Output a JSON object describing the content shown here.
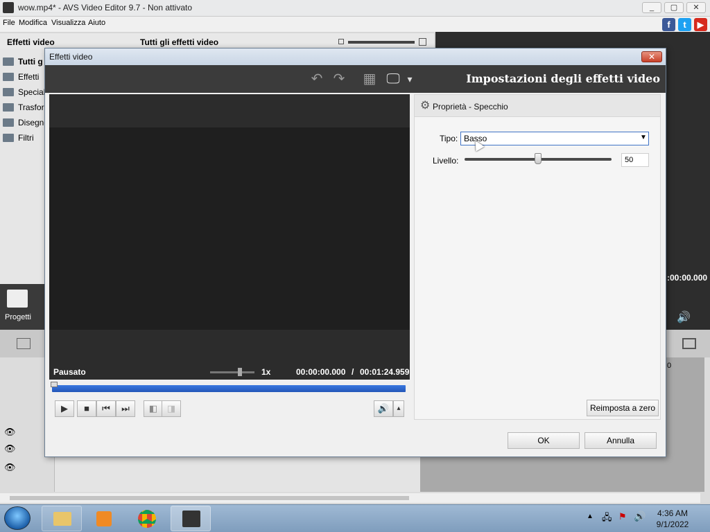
{
  "app": {
    "title": "wow.mp4* - AVS Video Editor 9.7 - Non attivato",
    "menu": [
      "File",
      "Modifica",
      "Visualizza",
      "Aiuto"
    ],
    "left_header": "Effetti video",
    "center_header": "Tutti gli effetti video",
    "folders": [
      "Tutti g",
      "Effetti",
      "Speciali",
      "Trasfor",
      "Disegno",
      "Filtri"
    ],
    "projects_label": "Progetti",
    "right_time": ":00:00.000",
    "tl_zero": "0"
  },
  "dialog": {
    "title": "Effetti video",
    "close_glyph": "✕",
    "heading": "Impostazioni degli effetti video",
    "toolbar": {
      "undo_icon": "↶",
      "redo_icon": "↷",
      "grid_icon": "▦",
      "monitor_icon": "🖵",
      "dropdown_icon": "▾"
    },
    "status": "Pausato",
    "speed": "1x",
    "time_current": "00:00:00.000",
    "time_sep": "/",
    "time_total": "00:01:24.959",
    "controls": {
      "play": "▶",
      "stop": "■",
      "prev": "⏮",
      "next": "⏭",
      "split": "◧",
      "split2": "◨",
      "volume": "🔊",
      "vol_up": "▴"
    },
    "props": {
      "title": "Proprietà - Specchio",
      "gear_icon": "⚙",
      "tipo_label": "Tipo:",
      "tipo_value": "Basso",
      "tipo_arrow": "▼",
      "livello_label": "Livello:",
      "livello_value": "50",
      "livello_fraction": 0.5,
      "reset_label": "Reimposta a zero"
    },
    "ok_label": "OK",
    "cancel_label": "Annulla"
  },
  "taskbar": {
    "time": "4:36 AM",
    "date": "9/1/2022"
  },
  "colors": {
    "accent": "#2356b8",
    "dark_panel": "#3b3b3b",
    "preview_bg": "#1f1f1f"
  }
}
